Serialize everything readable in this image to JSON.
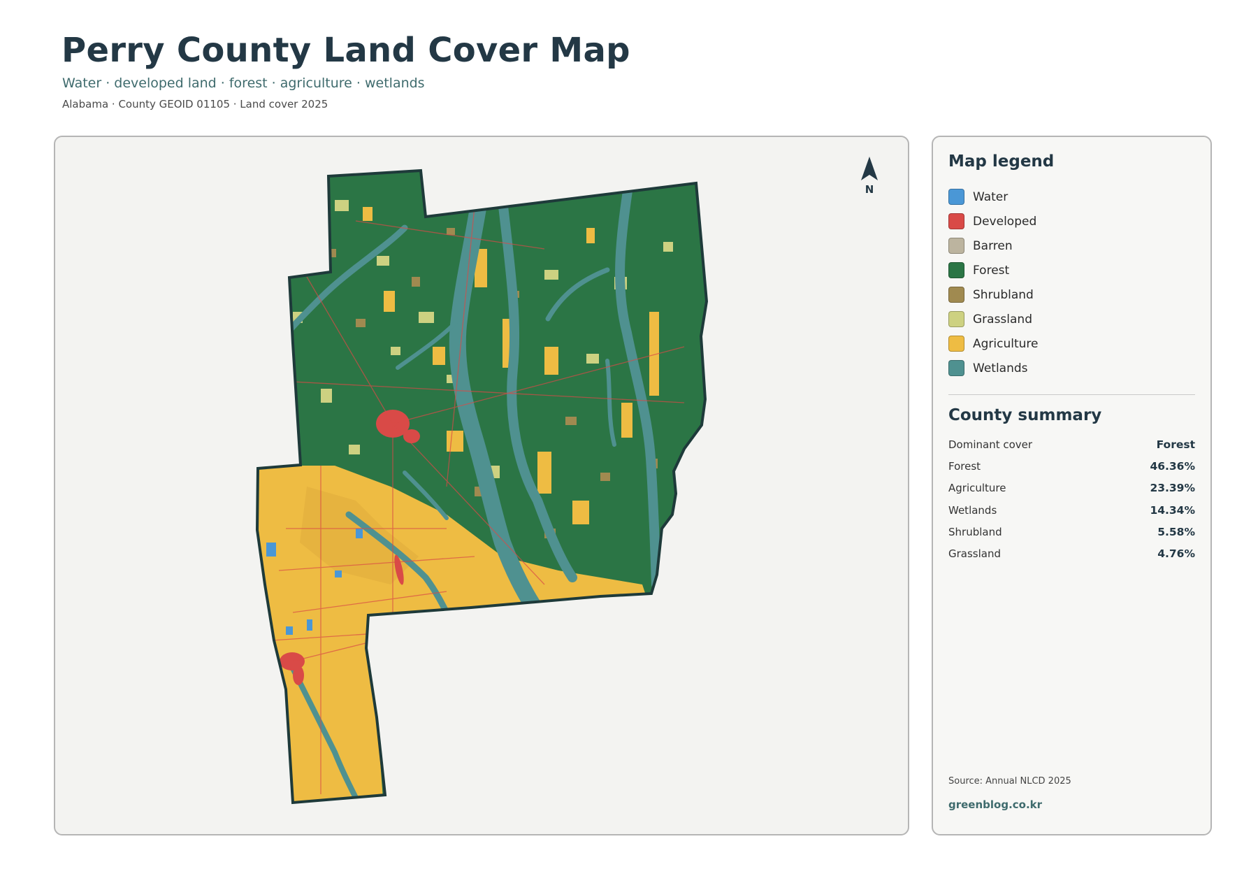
{
  "header": {
    "title": "Perry County Land Cover Map",
    "subtitle": "Water · developed land · forest · agriculture · wetlands",
    "meta": "Alabama · County GEOID 01105 · Land cover 2025"
  },
  "map": {
    "north_label": "N",
    "colors": {
      "water": "#4a97d6",
      "developed": "#d94a47",
      "barren": "#bcb49f",
      "forest": "#2b7545",
      "shrubland": "#a08a50",
      "grassland": "#cdd181",
      "agriculture": "#eebc43",
      "wetlands": "#4f9190",
      "background": "#f3f3f1",
      "outline": "#1e3a3a"
    }
  },
  "legend": {
    "title": "Map legend",
    "items": [
      {
        "label": "Water",
        "color": "#4a97d6"
      },
      {
        "label": "Developed",
        "color": "#d94a47"
      },
      {
        "label": "Barren",
        "color": "#bcb49f"
      },
      {
        "label": "Forest",
        "color": "#2b7545"
      },
      {
        "label": "Shrubland",
        "color": "#a08a50"
      },
      {
        "label": "Grassland",
        "color": "#cdd181"
      },
      {
        "label": "Agriculture",
        "color": "#eebc43"
      },
      {
        "label": "Wetlands",
        "color": "#4f9190"
      }
    ]
  },
  "summary": {
    "title": "County summary",
    "rows": [
      {
        "key": "Dominant cover",
        "value": "Forest"
      },
      {
        "key": "Forest",
        "value": "46.36%"
      },
      {
        "key": "Agriculture",
        "value": "23.39%"
      },
      {
        "key": "Wetlands",
        "value": "14.34%"
      },
      {
        "key": "Shrubland",
        "value": "5.58%"
      },
      {
        "key": "Grassland",
        "value": "4.76%"
      }
    ]
  },
  "footer": {
    "source": "Source: Annual NLCD 2025",
    "site": "greenblog.co.kr"
  }
}
